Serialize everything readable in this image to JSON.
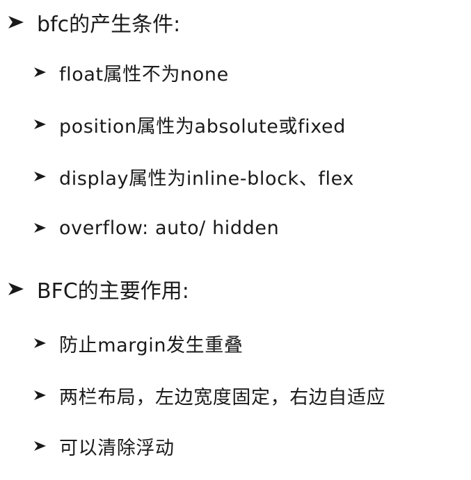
{
  "sections": [
    {
      "heading": "bfc的产生条件:",
      "items": [
        "float属性不为none",
        "position属性为absolute或fixed",
        "display属性为inline-block、flex",
        "overflow: auto/ hidden"
      ]
    },
    {
      "heading": "BFC的主要作用:",
      "items": [
        "防止margin发生重叠",
        "两栏布局，左边宽度固定，右边自适应",
        "可以清除浮动"
      ]
    }
  ],
  "bullet_icon": "arrowhead-bullet-icon"
}
